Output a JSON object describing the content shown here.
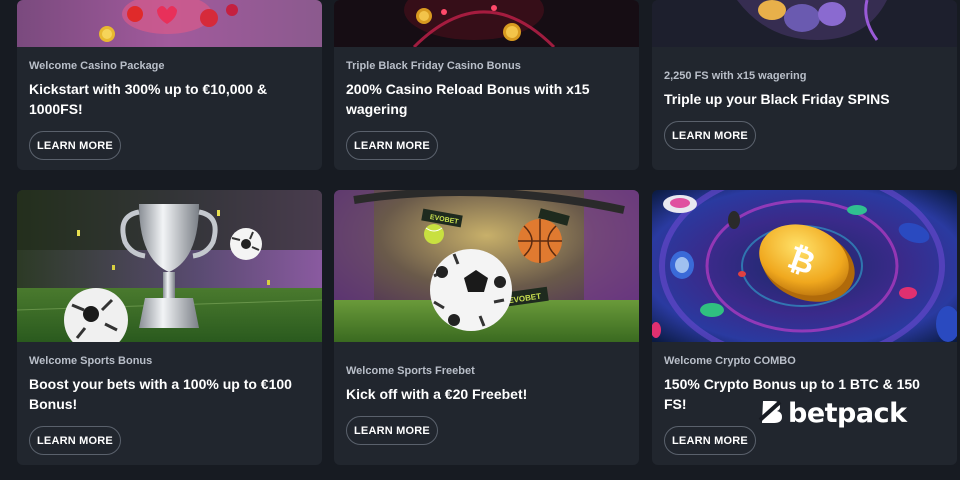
{
  "cards": [
    {
      "subtitle": "Welcome Casino Package",
      "title": "Kickstart with 300% up to €10,000 & 1000FS!",
      "button": "LEARN MORE",
      "image": "casino-slot-hearts"
    },
    {
      "subtitle": "Triple Black Friday Casino Bonus",
      "title": "200% Casino Reload Bonus with x15 wagering",
      "button": "LEARN MORE",
      "image": "casino-coins-neon"
    },
    {
      "subtitle": "2,250 FS with x15 wagering",
      "title": "Triple up your Black Friday SPINS",
      "button": "LEARN MORE",
      "image": "casino-characters"
    },
    {
      "subtitle": "Welcome Sports Bonus",
      "title": "Boost your bets with a 100% up to €100 Bonus!",
      "button": "LEARN MORE",
      "image": "trophy-football-stadium"
    },
    {
      "subtitle": "Welcome Sports Freebet",
      "title": "Kick off with a €20 Freebet!",
      "button": "LEARN MORE",
      "image": "football-basketball-stadium",
      "banner_text": "EVOBET"
    },
    {
      "subtitle": "Welcome Crypto COMBO",
      "title": "150% Crypto Bonus up to 1 BTC & 150 FS!",
      "button": "LEARN MORE",
      "image": "bitcoin-coin-tunnel"
    }
  ],
  "watermark": {
    "text": "betpack",
    "icon": "betpack-logo-icon"
  },
  "colors": {
    "background": "#171b22",
    "card": "#21262e",
    "button_border": "#5a616c",
    "subtitle": "#b9bfc9"
  }
}
